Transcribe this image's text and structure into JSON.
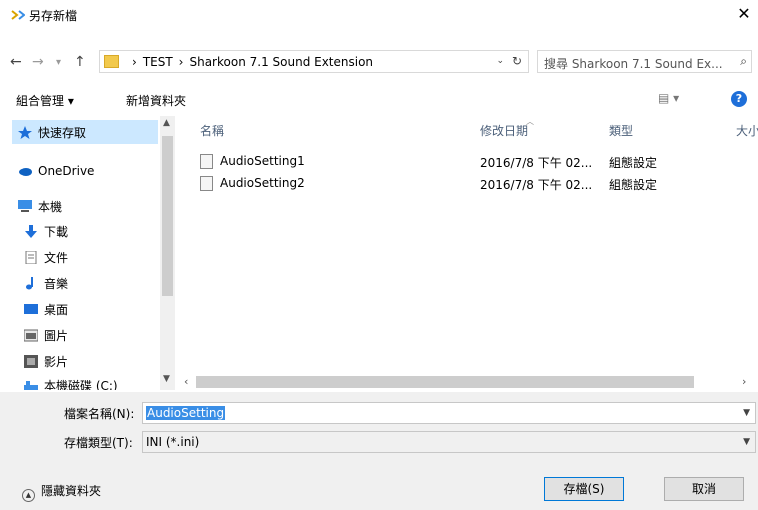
{
  "window": {
    "title": "另存新檔",
    "close_label": "✕"
  },
  "nav": {
    "back": "←",
    "forward": "→",
    "recent": "▾",
    "up": "↑",
    "breadcrumb": [
      "TEST",
      "Sharkoon 7.1 Sound Extension"
    ],
    "crumb_separator": "›",
    "dropdown": "⌄",
    "refresh": "↻",
    "search_placeholder": "搜尋 Sharkoon 7.1 Sound Ex...",
    "search_icon": "⌕"
  },
  "toolbar": {
    "organize_label": "組合管理 ▾",
    "new_folder_label": "新增資料夾",
    "views_label": "▤ ▾",
    "help_label": "?"
  },
  "sidebar": {
    "items": [
      {
        "label": "快速存取",
        "icon": "star-icon",
        "color": "#1e6fd9"
      },
      {
        "label": "OneDrive",
        "icon": "cloud-icon",
        "color": "#0f62c2"
      },
      {
        "label": "本機",
        "icon": "computer-icon",
        "color": "#3a8ee6"
      },
      {
        "label": "下載",
        "icon": "download-icon",
        "color": "#1e6fd9"
      },
      {
        "label": "文件",
        "icon": "document-icon",
        "color": "#777777"
      },
      {
        "label": "音樂",
        "icon": "music-icon",
        "color": "#1e6fd9"
      },
      {
        "label": "桌面",
        "icon": "desktop-icon",
        "color": "#1e6fd9"
      },
      {
        "label": "圖片",
        "icon": "picture-icon",
        "color": "#666666"
      },
      {
        "label": "影片",
        "icon": "video-icon",
        "color": "#555555"
      },
      {
        "label": "本機磁碟 (C:)",
        "icon": "drive-icon",
        "color": "#3a8ee6"
      }
    ]
  },
  "filelist": {
    "columns": [
      "名稱",
      "修改日期",
      "類型",
      "大小"
    ],
    "rows": [
      {
        "name": "AudioSetting1",
        "date": "2016/7/8 下午 02...",
        "type": "組態設定"
      },
      {
        "name": "AudioSetting2",
        "date": "2016/7/8 下午 02...",
        "type": "組態設定"
      }
    ]
  },
  "form": {
    "filename_label": "檔案名稱(N):",
    "filename_value": "AudioSetting",
    "filetype_label": "存檔類型(T):",
    "filetype_value": "INI (*.ini)",
    "save_label": "存檔(S)",
    "cancel_label": "取消",
    "hide_folders_label": "隱藏資料夾"
  },
  "colors": {
    "selection_bg": "#cce8ff",
    "text_selection": "#3a8ee6",
    "accent": "#0078d7"
  }
}
